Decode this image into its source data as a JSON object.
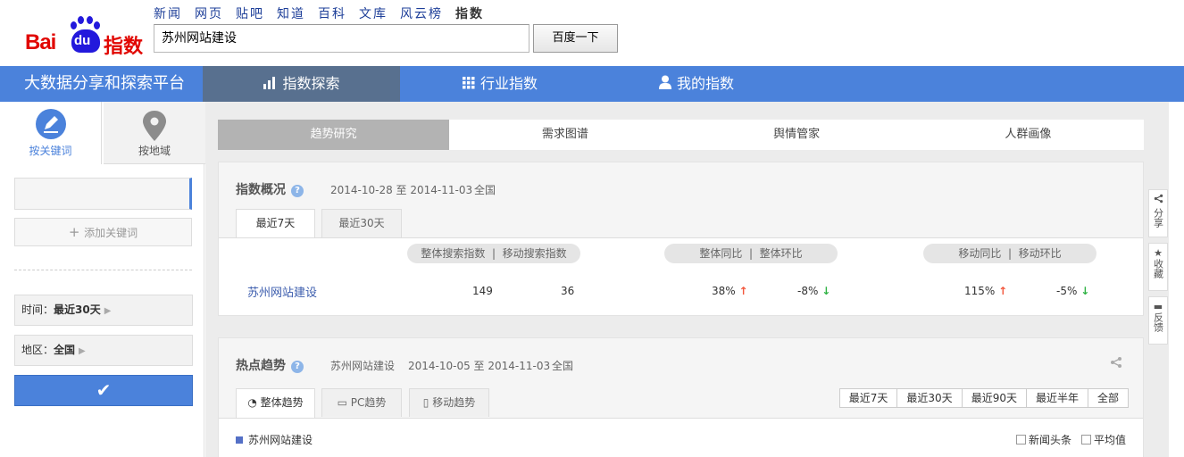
{
  "header": {
    "logo_text_bai": "Bai",
    "logo_text_du": "du",
    "logo_text_product": "指数",
    "top_nav": [
      "新闻",
      "网页",
      "贴吧",
      "知道",
      "百科",
      "文库",
      "风云榜",
      "指数"
    ],
    "active_nav_index": 7,
    "search_value": "苏州网站建设",
    "search_button": "百度一下"
  },
  "navbar": {
    "platform_title": "大数据分享和探索平台",
    "tabs": [
      {
        "label": "指数探索",
        "icon": "bar-chart-icon",
        "active": true
      },
      {
        "label": "行业指数",
        "icon": "grid-icon",
        "active": false
      },
      {
        "label": "我的指数",
        "icon": "user-icon",
        "active": false
      }
    ]
  },
  "sidebar": {
    "tab_keyword": "按关键词",
    "tab_region": "按地域",
    "add_keyword": "添加关键词",
    "time_label": "时间：",
    "time_value": "最近30天",
    "region_label": "地区：",
    "region_value": "全国",
    "confirm_symbol": "✔"
  },
  "subtabs": [
    "趋势研究",
    "需求图谱",
    "舆情管家",
    "人群画像"
  ],
  "overview": {
    "title": "指数概况",
    "help": "?",
    "date_range": "2014-10-28 至 2014-11-03",
    "region": "全国",
    "tabs": [
      "最近7天",
      "最近30天"
    ],
    "header_search": "整体搜索指数",
    "header_mobile_search": "移动搜索指数",
    "header_overall_yoy": "整体同比",
    "header_overall_mom": "整体环比",
    "header_mobile_yoy": "移动同比",
    "header_mobile_mom": "移动环比",
    "separator": "|",
    "row": {
      "keyword": "苏州网站建设",
      "overall_index": "149",
      "mobile_index": "36",
      "overall_yoy": "38%",
      "overall_mom": "-8%",
      "mobile_yoy": "115%",
      "mobile_mom": "-5%"
    },
    "colors": {
      "up": "#f3583e",
      "down": "#2fb344"
    }
  },
  "hot_trend": {
    "title": "热点趋势",
    "help": "?",
    "keyword": "苏州网站建设",
    "date_range": "2014-10-05 至 2014-11-03",
    "region": "全国",
    "tabs": [
      "整体趋势",
      "PC趋势",
      "移动趋势"
    ],
    "range_buttons": [
      "最近7天",
      "最近30天",
      "最近90天",
      "最近半年",
      "全部"
    ],
    "legend_keyword": "苏州网站建设",
    "check_news": "新闻头条",
    "check_avg": "平均值"
  },
  "float_buttons": {
    "share": "分享",
    "favorite": "收藏",
    "feedback": "反馈"
  },
  "colors": {
    "brand_blue": "#4b82db",
    "active_nav": "#58708f",
    "baidu_red": "#e10601"
  }
}
